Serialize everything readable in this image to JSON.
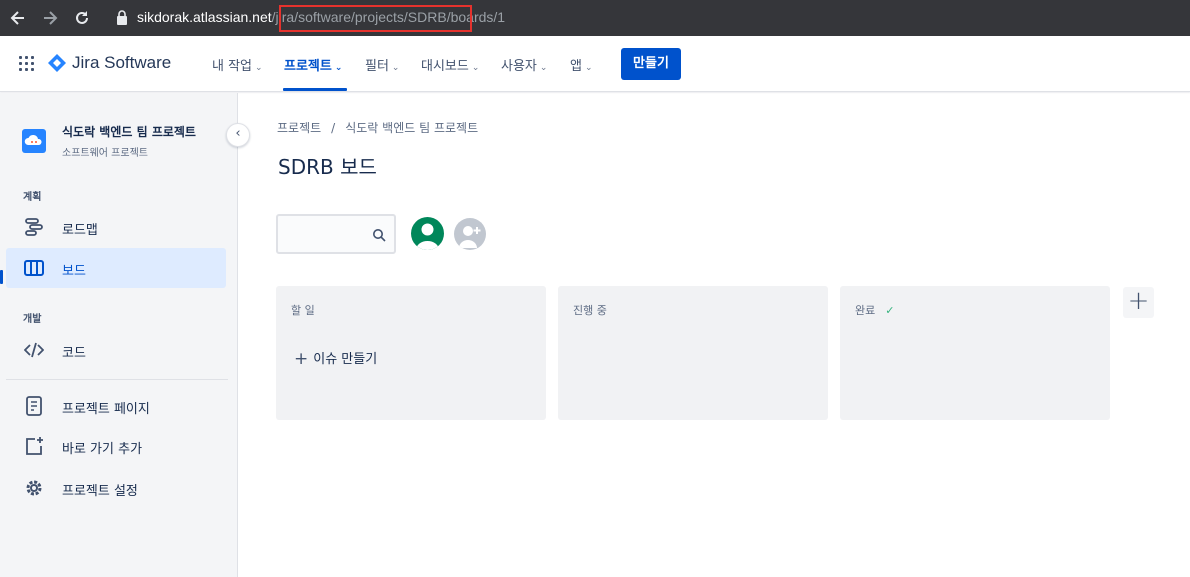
{
  "browser": {
    "url_host": "sikdorak.atlassian.net",
    "url_path": "/jira/software/projects/SDRB/boards/1",
    "back_icon": "arrow-left-icon",
    "forward_icon": "arrow-right-icon",
    "reload_icon": "reload-icon",
    "lock_icon": "lock-icon",
    "highlight_color": "#e5322d"
  },
  "topnav": {
    "app_name": "Jira Software",
    "items": [
      {
        "label": "내 작업"
      },
      {
        "label": "프로젝트",
        "active": true
      },
      {
        "label": "필터"
      },
      {
        "label": "대시보드"
      },
      {
        "label": "사용자"
      },
      {
        "label": "앱"
      }
    ],
    "create_label": "만들기",
    "accent_color": "#0052cc"
  },
  "sidebar": {
    "project_name": "식도락 백엔드 팀 프로젝트",
    "project_type": "소프트웨어 프로젝트",
    "sections": {
      "planning": "계획",
      "development": "개발"
    },
    "items": {
      "roadmap": "로드맵",
      "board": "보드",
      "code": "코드",
      "project_pages": "프로젝트 페이지",
      "add_shortcut": "바로 가기 추가",
      "project_settings": "프로젝트 설정"
    },
    "selected": "board"
  },
  "main": {
    "breadcrumb": [
      "프로젝트",
      "식도락 백엔드 팀 프로젝트"
    ],
    "breadcrumb_sep": "/",
    "title": "SDRB 보드",
    "columns": [
      {
        "title": "할 일",
        "create_issue": "이슈 만들기"
      },
      {
        "title": "진행 중"
      },
      {
        "title": "완료",
        "done": true
      }
    ]
  }
}
